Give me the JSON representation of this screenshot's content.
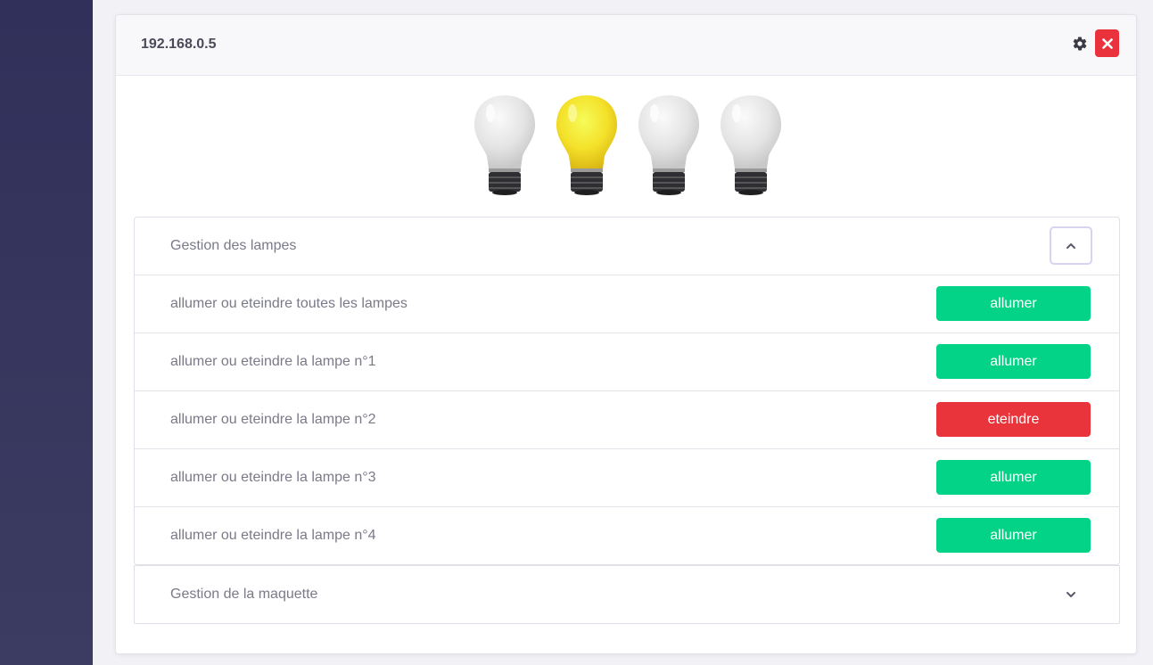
{
  "header": {
    "title": "192.168.0.5"
  },
  "colors": {
    "sidebar": "#30305a",
    "on_button": "#02d386",
    "off_button": "#e9343b",
    "close_button": "#e9323b",
    "bulb_on": "#f5e52a",
    "bulb_off": "#e6e6e6"
  },
  "bulbs": [
    {
      "state": "off"
    },
    {
      "state": "on"
    },
    {
      "state": "off"
    },
    {
      "state": "off"
    }
  ],
  "lamp_section": {
    "title": "Gestion des lampes",
    "toggle_icon": "chevron-up-icon",
    "rows": [
      {
        "label": "allumer ou eteindre toutes les lampes",
        "button": "allumer",
        "state": "on"
      },
      {
        "label": "allumer ou eteindre la lampe n°1",
        "button": "allumer",
        "state": "on"
      },
      {
        "label": "allumer ou eteindre la lampe n°2",
        "button": "eteindre",
        "state": "off"
      },
      {
        "label": "allumer ou eteindre la lampe n°3",
        "button": "allumer",
        "state": "on"
      },
      {
        "label": "allumer ou eteindre la lampe n°4",
        "button": "allumer",
        "state": "on"
      }
    ]
  },
  "model_section": {
    "title": "Gestion de la maquette",
    "toggle_icon": "chevron-down-icon"
  },
  "icons": {
    "settings": "gear-icon",
    "close": "close-icon"
  }
}
